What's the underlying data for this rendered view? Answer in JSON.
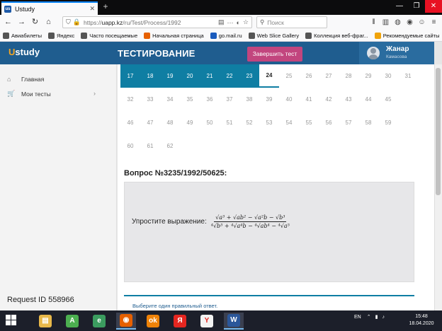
{
  "browser": {
    "tab_title": "Ustudy",
    "tab_favicon": "us",
    "url_prefix": "https://",
    "url_host": "uapp.kz",
    "url_path": "/ru/Test/Process/1992",
    "search_placeholder": "Поиск",
    "bookmarks": [
      {
        "label": "Авиабилеты",
        "icon": "gear-icon",
        "color": "#555555"
      },
      {
        "label": "Яндекс",
        "icon": "gear-icon",
        "color": "#555555"
      },
      {
        "label": "Часто посещаемые",
        "icon": "gear-icon",
        "color": "#555555"
      },
      {
        "label": "Начальная страница",
        "icon": "firefox-icon",
        "color": "#e66000"
      },
      {
        "label": "go.mail.ru",
        "icon": "mailru-icon",
        "color": "#1a5bbd"
      },
      {
        "label": "Web Slice Gallery",
        "icon": "gear-icon",
        "color": "#555555"
      },
      {
        "label": "Коллекция веб-фраг...",
        "icon": "gear-icon",
        "color": "#555555"
      },
      {
        "label": "Рекомендуемые сайты",
        "icon": "ie-icon",
        "color": "#f0a30a"
      }
    ]
  },
  "app": {
    "logo_first": "U",
    "logo_rest": "study",
    "title": "ТЕСТИРОВАНИЕ",
    "finish_button": "Завершить тест",
    "user_name": "Жанар",
    "user_surname": "Камасова",
    "colors": {
      "header": "#1f5d8f",
      "accent": "#0f7ea3",
      "finish": "#c2457e"
    }
  },
  "sidebar": {
    "items": [
      {
        "label": "Главная",
        "icon": "home-icon"
      },
      {
        "label": "Мои тесты",
        "icon": "cart-icon"
      }
    ],
    "request_id": "Request ID 558966"
  },
  "questions": {
    "rows": [
      [
        "17",
        "18",
        "19",
        "20",
        "21",
        "22",
        "23",
        "24",
        "25",
        "26",
        "27",
        "28",
        "29",
        "30",
        "31"
      ],
      [
        "32",
        "33",
        "34",
        "35",
        "36",
        "37",
        "38",
        "39",
        "40",
        "41",
        "42",
        "43",
        "44",
        "45"
      ],
      [
        "46",
        "47",
        "48",
        "49",
        "50",
        "51",
        "52",
        "53",
        "54",
        "55",
        "56",
        "57",
        "58",
        "59"
      ],
      [
        "60",
        "61",
        "62"
      ]
    ],
    "answered": [
      "17",
      "18",
      "19",
      "20",
      "21",
      "22",
      "23"
    ],
    "current": "24"
  },
  "question": {
    "title": "Вопрос №3235/1992/50625:",
    "prompt": "Упростите выражение:",
    "numerator": "√a³ + √ab² − √a²b − √b³",
    "denominator": "⁴√b⁵ + ⁴√a⁴b − ⁴√ab⁴ − ⁴√a⁵",
    "instruction": "Выберите один правильный ответ."
  },
  "taskbar": {
    "apps": [
      {
        "name": "explorer",
        "label": "▤",
        "color": "#e8b84a"
      },
      {
        "name": "app-a",
        "label": "A",
        "color": "#4caf50"
      },
      {
        "name": "app-e",
        "label": "e",
        "color": "#3b9c5f"
      },
      {
        "name": "firefox",
        "label": "◉",
        "color": "#e66000"
      },
      {
        "name": "odnoklassniki",
        "label": "ok",
        "color": "#ee8208"
      },
      {
        "name": "yandex",
        "label": "Я",
        "color": "#e52620"
      },
      {
        "name": "yandex-browser",
        "label": "Y",
        "color": "#f2f2f2"
      },
      {
        "name": "word",
        "label": "W",
        "color": "#2b579a"
      }
    ],
    "lang": "EN",
    "time": "15:48",
    "date": "18.04.2020"
  }
}
